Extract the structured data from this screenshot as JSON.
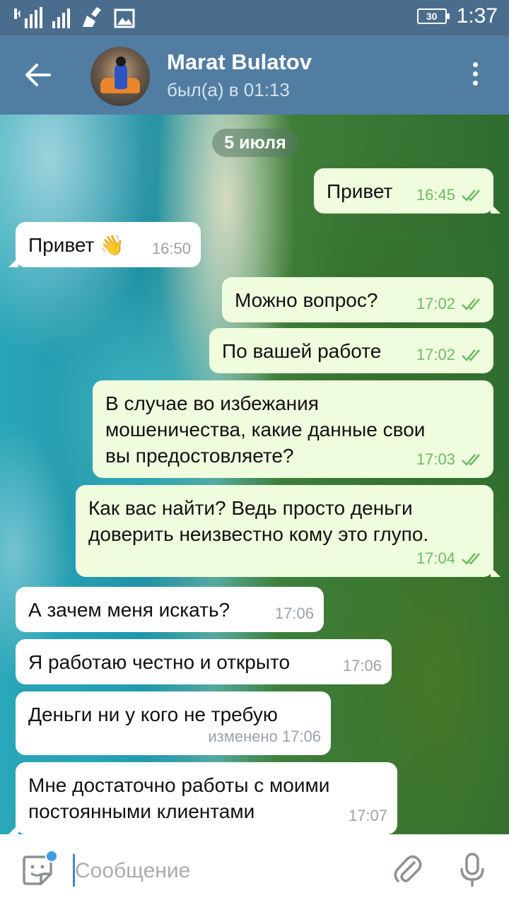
{
  "status_bar": {
    "network": "H",
    "battery": "30",
    "time": "1:37"
  },
  "header": {
    "contact_name": "Marat Bulatov",
    "contact_status": "был(а) в 01:13"
  },
  "chat": {
    "date_separator": "5 июля",
    "messages": [
      {
        "dir": "out",
        "text": "Привет",
        "time": "16:45"
      },
      {
        "dir": "in",
        "text": "Привет 👋",
        "time": "16:50"
      },
      {
        "dir": "out",
        "text": "Можно вопрос?",
        "time": "17:02"
      },
      {
        "dir": "out",
        "text": "По вашей работе",
        "time": "17:02"
      },
      {
        "dir": "out",
        "text": "В случае во избежания\nмошеничества, какие данные свои\nвы предостовляете?",
        "time": "17:03"
      },
      {
        "dir": "out",
        "text": "Как вас найти? Ведь просто деньги\nдоверить неизвестно кому это глупо.",
        "time": "17:04"
      },
      {
        "dir": "in",
        "text": "А зачем меня искать?",
        "time": "17:06"
      },
      {
        "dir": "in",
        "text": "Я работаю честно и открыто",
        "time": "17:06"
      },
      {
        "dir": "in",
        "text": "Деньги ни у кого не требую",
        "time": "изменено 17:06"
      },
      {
        "dir": "in",
        "text": "Мне достаточно работы с моими\nпостоянными клиентами",
        "time": "17:07"
      }
    ]
  },
  "input": {
    "placeholder": "Сообщение",
    "value": ""
  },
  "colors": {
    "header": "#527da3",
    "status_bar": "#4b6d8d",
    "outgoing_bubble": "#effdde",
    "incoming_bubble": "#ffffff",
    "read_ticks": "#6fbb63"
  },
  "icons": [
    "back-arrow-icon",
    "more-vertical-icon",
    "sticker-icon",
    "paperclip-icon",
    "microphone-icon",
    "double-check-icon"
  ]
}
